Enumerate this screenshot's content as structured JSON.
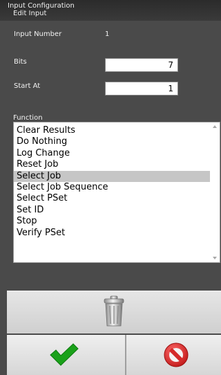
{
  "header": {
    "title": "Input Configuration",
    "subtitle": "Edit Input"
  },
  "fields": {
    "input_number_label": "Input Number",
    "input_number_value": "1",
    "bits_label": "Bits",
    "bits_value": "7",
    "start_at_label": "Start At",
    "start_at_value": "1"
  },
  "function": {
    "label": "Function",
    "selected": "Select Job",
    "items": [
      "Clear Results",
      "Do Nothing",
      "Log Change",
      "Reset Job",
      "Select Job",
      "Select Job Sequence",
      "Select PSet",
      "Set ID",
      "Stop",
      "Verify PSet"
    ]
  },
  "icons": {
    "delete": "trash-icon",
    "ok": "check-icon",
    "cancel": "cancel-icon"
  },
  "colors": {
    "background": "#4a4a4a",
    "selection": "#c6c6c6",
    "ok_green": "#1aa11a",
    "cancel_red": "#d42a2a"
  }
}
